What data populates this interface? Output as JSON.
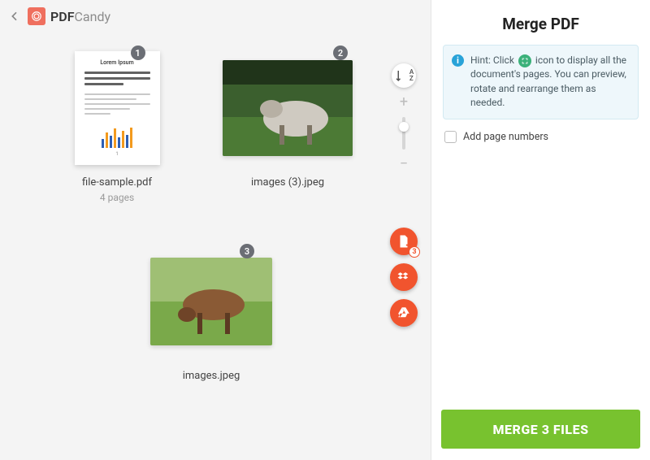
{
  "brand": {
    "name1": "PDF",
    "name2": "Candy"
  },
  "files": [
    {
      "name": "file-sample.pdf",
      "pages": "4 pages",
      "badge": "1",
      "doc_title": "Lorem Ipsum"
    },
    {
      "name": "images (3).jpeg",
      "badge": "2"
    },
    {
      "name": "images.jpeg",
      "badge": "3"
    }
  ],
  "controls": {
    "sort_label": "A\nZ",
    "add_count": "3"
  },
  "panel": {
    "title": "Merge PDF",
    "hint_pre": "Hint: Click",
    "hint_post": "icon to display all the document's pages. You can preview, rotate and rearrange them as needed.",
    "checkbox_label": "Add page numbers",
    "merge_label": "MERGE 3 FILES"
  },
  "colors": {
    "accent": "#f1542e",
    "cta": "#78c22f",
    "hint_bg": "#eef7fb"
  }
}
